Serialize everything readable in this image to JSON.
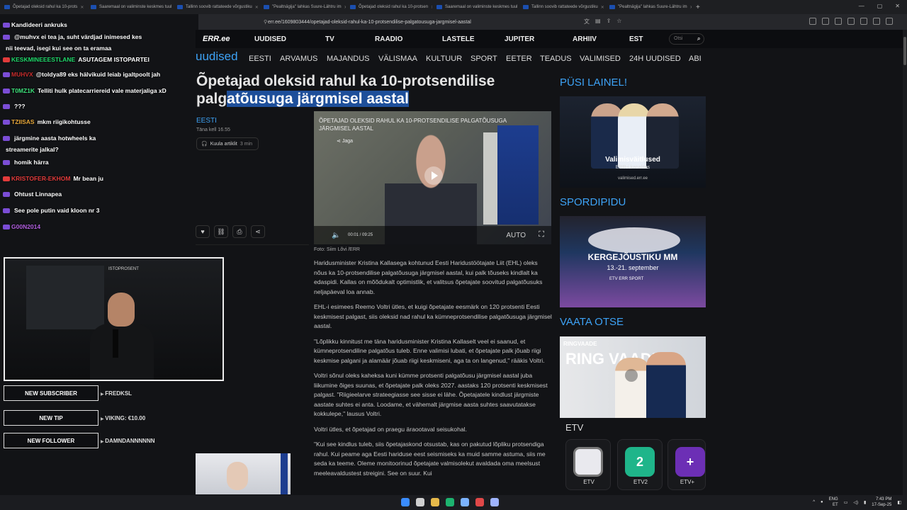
{
  "browser": {
    "tabs": [
      "Õpetajad oleksid rahul ka 10-prots",
      "Saaremaal on valiminste keskmes tuul",
      "Tallinn soovib rattateede võrgustiku",
      "\"Pealtnägija\" lahkas Suure-Lähtru im",
      "Õpetajad oleksid rahul ka 10-protsen",
      "Saaremaal on valiminste keskmes tuul",
      "Tallinn soovib rattateede võrgustiku",
      "\"Pealtnägija\" lahkas Suure-Lähtru im"
    ],
    "new_tab": "+",
    "url": "err.ee/1609803444/opetajad-oleksid-rahul-ka-10-protsendilise-palgatousuga-jargmisel-aastal",
    "window_controls": [
      "—",
      "▢",
      "✕"
    ]
  },
  "err": {
    "logo": "ERR.ee",
    "nav": [
      "UUDISED",
      "TV",
      "RAADIO",
      "LASTELE",
      "JUPITER",
      "ARHIIV",
      "EST"
    ],
    "search_placeholder": "Otsi",
    "brand": "uudised",
    "subnav": [
      "EESTI",
      "ARVAMUS",
      "MAJANDUS",
      "VÄLISMAA",
      "KULTUUR",
      "SPORT",
      "EETER",
      "TEADUS",
      "VALIMISED",
      "24H UUDISED",
      "ABI"
    ]
  },
  "article": {
    "headline_part1": "Õpetajad oleksid rahul ka 10-protsendilise palg",
    "headline_part2": "atõusuga järgmisel aastal",
    "section": "EESTI",
    "date": "Täna kell 16.55",
    "listen_label": "Kuula artiklit",
    "listen_minutes": "3 min",
    "video_title": "ÕPETAJAD OLEKSID RAHUL KA 10-PROTSENDILISE PALGATÕUSUGA JÄRGMISEL AASTAL",
    "video_share": "Jaga",
    "video_time": "00:01 / 09:25",
    "video_quality": "AUTO",
    "photo_credit": "Foto: Siim Lõvi /ERR",
    "paragraphs": [
      "Haridusminister Kristina Kallasega kohtunud Eesti Haridustöötajate Liit (EHL) oleks nõus ka 10-protsendilise palgatõusuga järgmisel aastal, kui palk tõuseks kindlalt ka edaspidi. Kallas on mõõdukalt optimistlik, et valitsus õpetajate soovitud palgatõusuks neljapäeval loa annab.",
      "EHL-i esimees Reemo Voltri ütles, et kuigi õpetajate eesmärk on 120 protsenti Eesti keskmisest palgast, siis oleksid nad rahul ka kümneprotsendilise palgatõusuga järgmisel aastal.",
      "\"Lõplikku kinnitust me täna haridusminister Kristina Kallaselt veel ei saanud, et kümneprotsendiline palgatõus tuleb. Enne valimisi lubati, et õpetajate palk jõuab riigi keskmise palgani ja alamäär jõuab riigi keskmiseni, aga ta on langenud,\" rääkis Voltri.",
      "Voltri sõnul oleks kaheksa kuni kümme protsenti palgatõusu järgmisel aastal juba liikumine õiges suunas, et õpetajate palk oleks 2027. aastaks 120 protsenti keskmisest palgast. \"Riigieelarve strateegiasse see sisse ei lähe. Õpetajatele kindlust järgmiste aastate suhtes ei anta. Loodame, et vähemalt järgmise aasta suhtes saavutatakse kokkulepe,\" lausus Voltri.",
      "Voltri ütles, et õpetajad on praegu äraootaval seisukohal.",
      "\"Kui see kindlus tuleb, siis õpetajaskond otsustab, kas on pakutud lõpliku protsendiga rahul. Kui peame aga Eesti hariduse eest seismiseks ka muid samme astuma, siis me seda ka teeme. Oleme monitoorinud õpetajate valmisolekut avaldada oma meelsust meeleavaldustest streigini. See on suur. Kui"
    ]
  },
  "sidebar": {
    "h1": "PÜSI LAINEL!",
    "card1": {
      "title": "Valimisväitlused",
      "sub": "ERR-i kanalites",
      "url": "valimised.err.ee"
    },
    "h2": "SPORDIPIDU",
    "card2": {
      "title": "KERGEJÕUSTIKU MM",
      "dates": "13.-21. september",
      "brand": "ETV ERR SPORT"
    },
    "h3": "VAATA OTSE",
    "card3": {
      "label": "RINGVAADE",
      "big": "RING VAADE"
    },
    "etv_label": "ETV",
    "channels": [
      {
        "name": "ETV",
        "glyph": "",
        "color": "#e9e9ee"
      },
      {
        "name": "ETV2",
        "glyph": "2",
        "color": "#1fb58a"
      },
      {
        "name": "ETV+",
        "glyph": "+",
        "color": "#6c2fb5"
      }
    ]
  },
  "stream": {
    "chat": [
      {
        "user": "Kandideeri ankruks",
        "text": "",
        "user_color": "#ffffff",
        "badge": "#7b4dd6"
      },
      {
        "user": "",
        "text": "@muhvx ei tea ja, suht värdjad inimesed kes",
        "user_color": "#6aa0ff",
        "badge": "#7b4dd6"
      },
      {
        "user": "",
        "text": "nii teevad, isegi kui see on ta eramaa",
        "user_color": "#ffffff",
        "badge": ""
      },
      {
        "user": "KESKMINEEESTLANE",
        "text": "ASUTAGEM ISTOPARTEI",
        "user_color": "#1fd86a",
        "badge": "#e23b3b"
      },
      {
        "user": "MUHVX",
        "text": "@toldya89 eks hälvikuid leiab igaltpoolt jah",
        "user_color": "#c72c2c",
        "badge": "#7b4dd6"
      },
      {
        "user": "T0MZ1K",
        "text": "Telliti hulk platecarriereid vale materjaliga xD",
        "user_color": "#3de07a",
        "badge": "#7b4dd6"
      },
      {
        "user": "",
        "text": "???",
        "user_color": "#5b4de0",
        "badge": "#7b4dd6"
      },
      {
        "user": "TZIISAS",
        "text": "mkm riigikohtusse",
        "user_color": "#e8a83a",
        "badge": "#7b4dd6"
      },
      {
        "user": "",
        "text": "järgmine aasta hotwheels ka",
        "user_color": "#5b4de0",
        "badge": "#7b4dd6"
      },
      {
        "user": "",
        "text": "streamerite jalkal?",
        "user_color": "#ffffff",
        "badge": ""
      },
      {
        "user": "",
        "text": "homik härra",
        "user_color": "#b25fe0",
        "badge": "#7b4dd6"
      },
      {
        "user": "KRISTOFER-EKHOM",
        "text": "Mr bean ju",
        "user_color": "#e23b3b",
        "badge": "#e23b3b"
      },
      {
        "user": "",
        "text": "Ohtust Linnapea",
        "user_color": "#5b4de0",
        "badge": "#7b4dd6"
      },
      {
        "user": "",
        "text": "See pole putin vaid kloon nr 3",
        "user_color": "#5b4de0",
        "badge": "#7b4dd6"
      },
      {
        "user": "G00N2014",
        "text": "",
        "user_color": "#b25fe0",
        "badge": "#7b4dd6"
      }
    ],
    "webcam_sign": "ISTOPROSENT",
    "alerts": [
      {
        "label": "NEW SUBSCRIBER",
        "value": "FREDKSL"
      },
      {
        "label": "NEW TIP",
        "value": "VIKING: €10.00"
      },
      {
        "label": "NEW FOLLOWER",
        "value": "DAMNDANNNNNN"
      }
    ]
  },
  "taskbar": {
    "lang": "ENG",
    "lang2": "ET",
    "time": "7:43 PM",
    "date": "17-Sep-25",
    "app_colors": [
      "#3a8cff",
      "#cfcfcf",
      "#e6b94a",
      "#1db36f",
      "#7bb3ff",
      "#e04848",
      "#9fb4ff"
    ]
  }
}
